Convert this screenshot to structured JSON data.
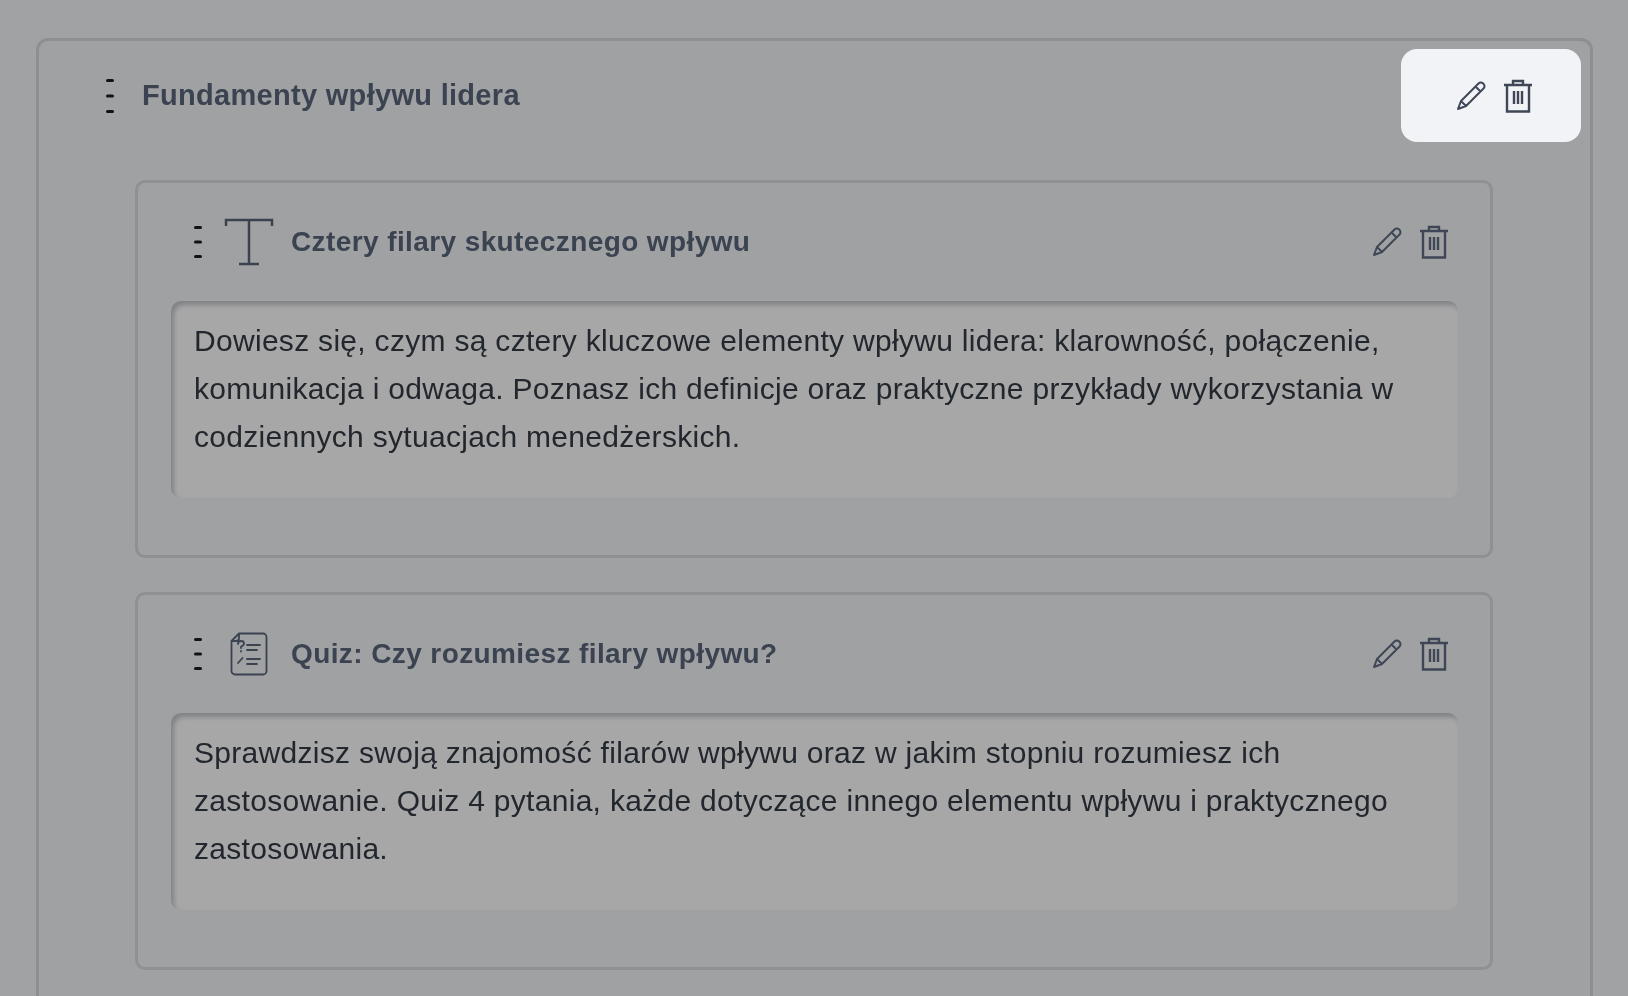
{
  "module": {
    "title": "Fundamenty wpływu lidera",
    "actions_highlighted": true
  },
  "lessons": [
    {
      "kind": "text",
      "title": "Cztery filary skutecznego wpływu",
      "description": "Dowiesz się, czym są cztery kluczowe elementy wpływu lidera: klarowność, połączenie, komunikacja i odwaga. Poznasz ich definicje oraz praktyczne przykłady wykorzystania w codziennych sytuacjach menedżerskich."
    },
    {
      "kind": "quiz",
      "title": "Quiz: Czy rozumiesz filary wpływu?",
      "description": "Sprawdzisz swoją znajomość filarów wpływu oraz w jakim stopniu rozumiesz ich zastosowanie. Quiz 4 pytania, każde dotyczące innego elementu wpływu i praktycznego zastosowania."
    }
  ]
}
